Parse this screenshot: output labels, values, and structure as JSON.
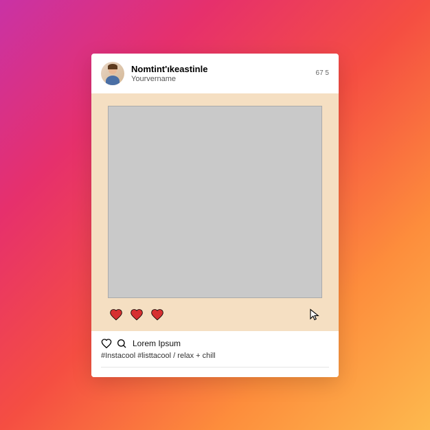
{
  "header": {
    "username": "Nomtint'ıkeastinle",
    "subname": "Yourvername",
    "meta": "67 5"
  },
  "footer": {
    "caption": "Lorem Ipsum",
    "hashtags": "#Instacool #listtacool / relax + chill"
  }
}
